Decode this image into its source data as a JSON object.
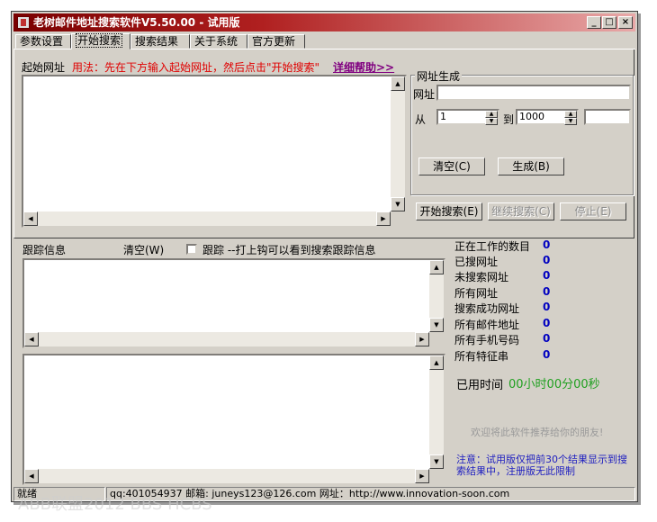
{
  "window": {
    "title": "老树邮件地址搜索软件V5.50.00 - 试用版",
    "min_label": "_",
    "max_label": "□",
    "close_label": "×"
  },
  "tabs": [
    "参数设置",
    "开始搜索",
    "搜索结果",
    "关于系统",
    "官方更新"
  ],
  "active_tab": "开始搜索",
  "start_url": {
    "label": "起始网址",
    "usage": "用法：先在下方输入起始网址，然后点击\"开始搜索\"",
    "help_link": "详细帮助>>"
  },
  "url_gen": {
    "legend": "网址生成",
    "url_label": "网址",
    "url_value": "",
    "from_label": "从",
    "from_value": "1",
    "to_label": "到",
    "to_value": "1000",
    "extra_value": "",
    "clear_btn": "清空(C)",
    "generate_btn": "生成(B)"
  },
  "actions": {
    "start": "开始搜索(E)",
    "continue": "继续搜索(C)",
    "stop": "停止(E)"
  },
  "trace": {
    "label": "跟踪信息",
    "clear": "清空(W)",
    "checkbox_label": "跟踪 --打上钩可以看到搜索跟踪信息",
    "checked": false
  },
  "stats": [
    {
      "label": "正在工作的数目",
      "value": "0"
    },
    {
      "label": "已搜网址",
      "value": "0"
    },
    {
      "label": "未搜索网址",
      "value": "0"
    },
    {
      "label": "所有网址",
      "value": "0"
    },
    {
      "label": "搜索成功网址",
      "value": "0"
    },
    {
      "label": "所有邮件地址",
      "value": "0"
    },
    {
      "label": "所有手机号码",
      "value": "0"
    },
    {
      "label": "所有特征串",
      "value": "0"
    }
  ],
  "elapsed": {
    "label": "已用时间",
    "value": "00小时00分00秒"
  },
  "recommend": "欢迎将此软件推荐给你的朋友!",
  "notice": "注意：试用版仅把前30个结果显示到搜索结果中，注册版无此限制",
  "statusbar": {
    "status": "就绪",
    "info": "qq:401054937 邮箱: juneys123@126.com 网址：http://www.innovation-soon.com"
  },
  "watermark": "ABB联盟2012 BBS HCBS"
}
